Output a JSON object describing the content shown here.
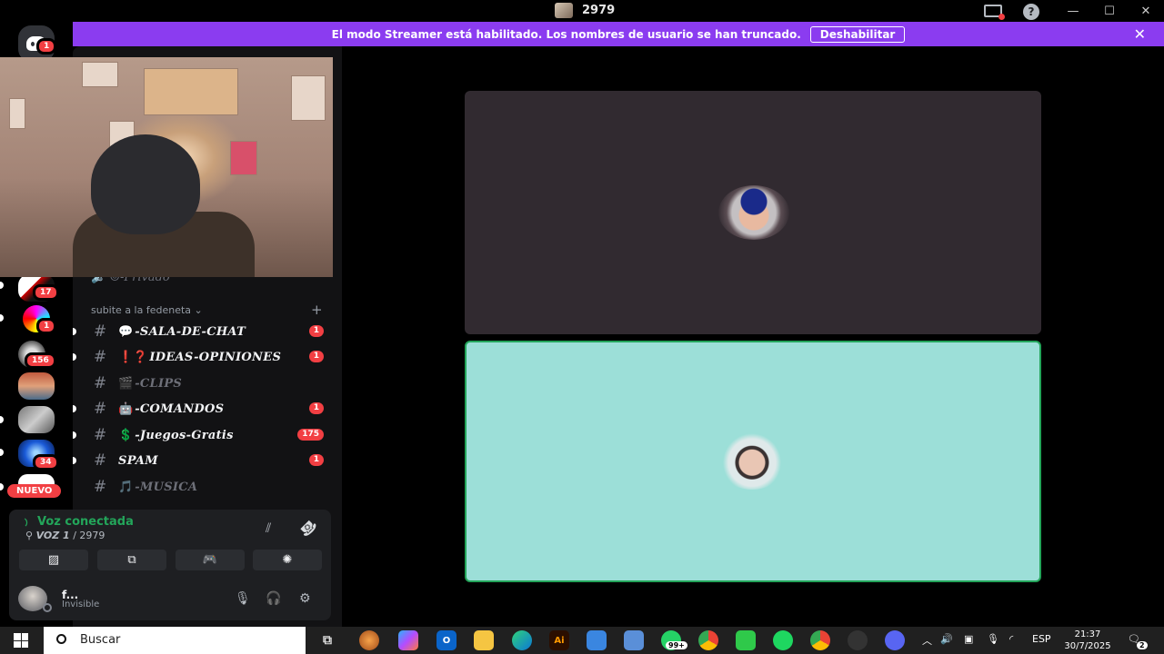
{
  "window": {
    "title": "2979",
    "minimize": "—",
    "maximize": "☐",
    "close": "✕",
    "help": "?"
  },
  "banner": {
    "text": "El modo Streamer está habilitado. Los nombres de usuario se han truncado.",
    "button": "Deshabilitar",
    "close": "✕"
  },
  "guilds": {
    "home_badge": "1",
    "badges": [
      "17",
      "1",
      "156",
      "34"
    ],
    "new_label": "NUEVO"
  },
  "channels": {
    "partial_channel": "🔈 ☺-Privado",
    "category": "subite a la fedeneta ⌄",
    "add": "+",
    "items": [
      {
        "hash": "#",
        "emoji": "💬",
        "name": "-SALA-DE-CHAT",
        "badge": "1",
        "muted": false
      },
      {
        "hash": "#",
        "emoji": "❗❓",
        "name": "IDEAS-OPINIONES",
        "badge": "1",
        "muted": false
      },
      {
        "hash": "#",
        "emoji": "🎬",
        "name": "-CLIPS",
        "badge": "",
        "muted": true
      },
      {
        "hash": "#",
        "emoji": "🤖",
        "name": "-COMANDOS",
        "badge": "1",
        "muted": false
      },
      {
        "hash": "#",
        "emoji": "💲",
        "name": "-Juegos-Gratis",
        "badge": "175",
        "muted": false
      },
      {
        "hash": "#",
        "emoji": "",
        "name": "SPAM",
        "badge": "1",
        "muted": false
      },
      {
        "hash": "#",
        "emoji": "🎵",
        "name": "-MUSICA",
        "badge": "",
        "muted": true
      }
    ]
  },
  "voice": {
    "status": "Voz conectada",
    "channel_prefix": "VOZ 1",
    "channel_suffix": " / 2979",
    "buttons": [
      "▨",
      "⧉",
      "🎮",
      "✺"
    ]
  },
  "user": {
    "name": "f...",
    "status": "Invisible",
    "mic": "🎙",
    "headset": "🎧",
    "settings": "⚙"
  },
  "taskbar": {
    "search": "Buscar",
    "whatsapp_badge": "99+",
    "language": "ESP",
    "time": "21:37",
    "date": "30/7/2025",
    "notifications": "2"
  },
  "colors": {
    "banner": "#8b3cf0",
    "connected": "#23a55a",
    "badge": "#f23f43",
    "tile_top": "#312a30",
    "tile_bottom": "#9cdfd8"
  }
}
